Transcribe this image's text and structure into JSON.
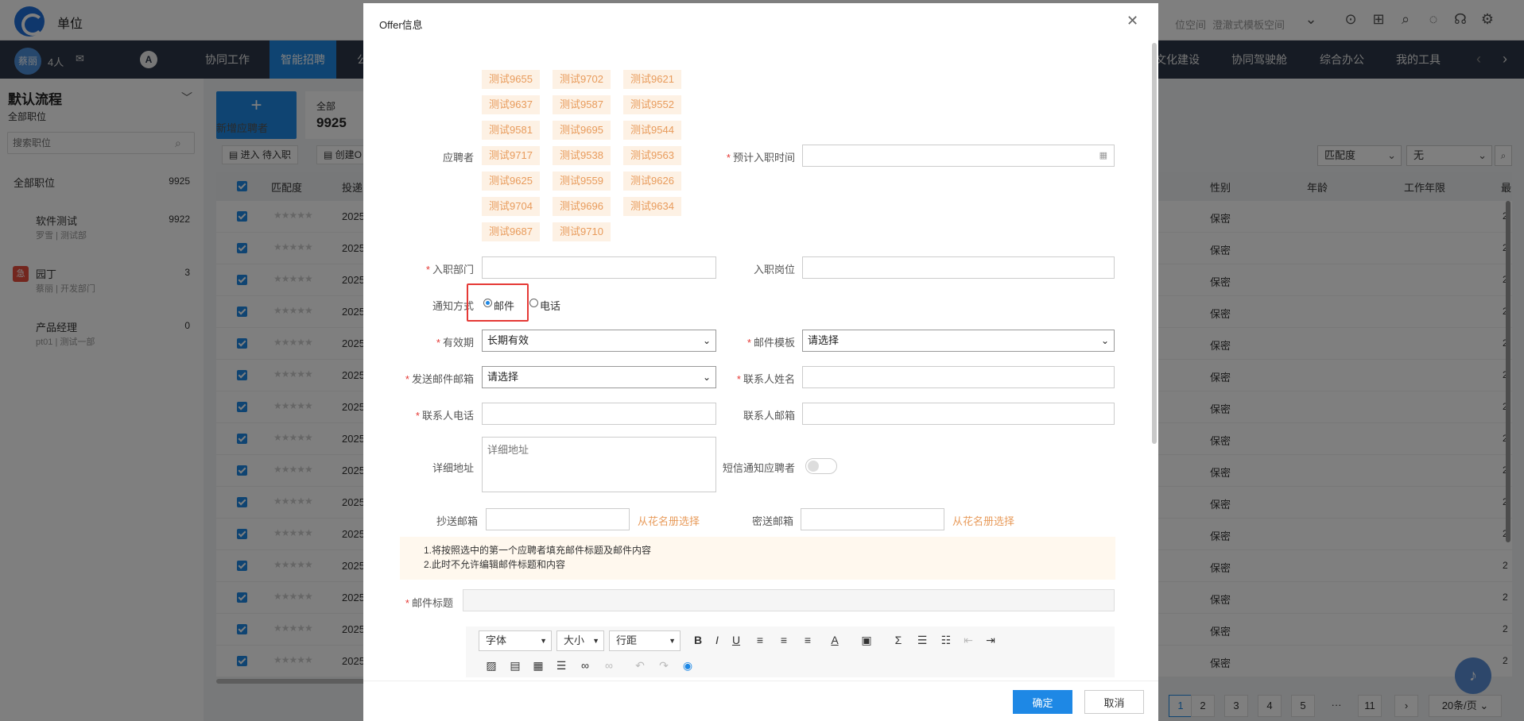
{
  "topbar": {
    "unit": "单位",
    "space_left": "位空间",
    "space_select": "澄澈式模板空间"
  },
  "nav": {
    "avatar_text": "蔡丽",
    "people": "4人",
    "items": [
      "协同工作",
      "智能招聘",
      "公",
      "文化建设",
      "协同驾驶舱",
      "综合办公",
      "我的工具"
    ]
  },
  "sidebar": {
    "title": "默认流程",
    "subtitle": "全部职位",
    "search_placeholder": "搜索职位",
    "all_label": "全部职位",
    "all_count": "9925",
    "positions": [
      {
        "name": "软件测试",
        "sub": "罗雪 | 测试部",
        "count": "9922",
        "urgent": ""
      },
      {
        "name": "园丁",
        "sub": "蔡丽 | 开发部门",
        "count": "3",
        "urgent": "急"
      },
      {
        "name": "产品经理",
        "sub": "pt01 | 测试一部",
        "count": "0",
        "urgent": ""
      }
    ]
  },
  "main": {
    "add_button": "新增应聘者",
    "stat_label": "全部",
    "stat_value": "9925",
    "action_1": "进入 待入职",
    "action_2": "创建O",
    "filter_1": "匹配度",
    "filter_2": "无",
    "headers": {
      "match": "匹配度",
      "deliver": "投递",
      "gender": "性别",
      "age": "年龄",
      "years": "工作年限",
      "last": "最"
    },
    "row_year": "2025",
    "row_gender": "保密",
    "row_tail": "2",
    "stars": "★★★★★",
    "pager": [
      "1",
      "2",
      "3",
      "4",
      "5",
      "···",
      "11",
      "20条/页"
    ]
  },
  "modal": {
    "title": "Offer信息",
    "applicant_label": "应聘者",
    "applicants": [
      "测试9655",
      "测试9702",
      "测试9621",
      "测试9637",
      "测试9587",
      "测试9552",
      "测试9581",
      "测试9695",
      "测试9544",
      "测试9717",
      "测试9538",
      "测试9563",
      "测试9625",
      "测试9559",
      "测试9626",
      "测试9704",
      "测试9696",
      "测试9634",
      "测试9687",
      "测试9710"
    ],
    "expected_date_label": "预计入职时间",
    "dept_label": "入职部门",
    "post_label": "入职岗位",
    "notify_label": "通知方式",
    "notify_email": "邮件",
    "notify_phone": "电话",
    "validity_label": "有效期",
    "validity_value": "长期有效",
    "template_label": "邮件模板",
    "template_value": "请选择",
    "sender_label": "发送邮件邮箱",
    "sender_value": "请选择",
    "contact_name_label": "联系人姓名",
    "contact_phone_label": "联系人电话",
    "contact_email_label": "联系人邮箱",
    "address_label": "详细地址",
    "address_placeholder": "详细地址",
    "sms_label": "短信通知应聘者",
    "cc_label": "抄送邮箱",
    "bcc_label": "密送邮箱",
    "pick_link": "从花名册选择",
    "notice_1": "1.将按照选中的第一个应聘者填充邮件标题及邮件内容",
    "notice_2": "2.此时不允许编辑邮件标题和内容",
    "subject_label": "邮件标题",
    "editor": {
      "font": "字体",
      "size": "大小",
      "line": "行距"
    },
    "ok": "确定",
    "cancel": "取消"
  }
}
